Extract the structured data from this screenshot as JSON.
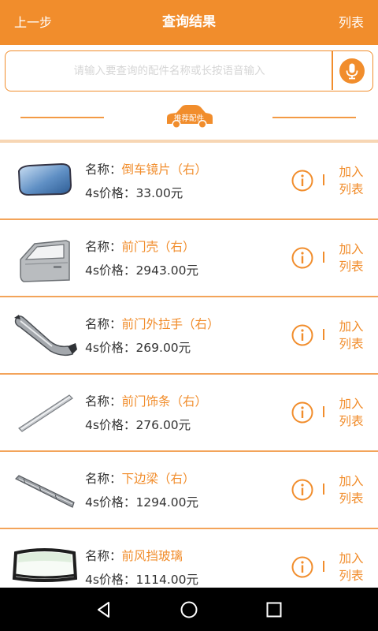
{
  "topbar": {
    "back_label": "上一步",
    "title": "查询结果",
    "list_label": "列表"
  },
  "search": {
    "placeholder": "请输入要查询的配件名称或长按语音输入",
    "mic_icon": "microphone-icon"
  },
  "recommend": {
    "label": "推荐配件",
    "icon": "car-icon"
  },
  "colors": {
    "accent": "#f18d2c",
    "divider": "#f3a45a",
    "text": "#333333"
  },
  "items": [
    {
      "name_prefix": "名称：",
      "name": "倒车镜片（右）",
      "price_prefix": "4s价格：",
      "price": "33.00元",
      "add_label_1": "加入",
      "add_label_2": "列表",
      "thumb": "mirror-glass-image"
    },
    {
      "name_prefix": "名称：",
      "name": "前门壳（右）",
      "price_prefix": "4s价格：",
      "price": "2943.00元",
      "add_label_1": "加入",
      "add_label_2": "列表",
      "thumb": "front-door-shell-image"
    },
    {
      "name_prefix": "名称：",
      "name": "前门外拉手（右）",
      "price_prefix": "4s价格：",
      "price": "269.00元",
      "add_label_1": "加入",
      "add_label_2": "列表",
      "thumb": "door-handle-image"
    },
    {
      "name_prefix": "名称：",
      "name": "前门饰条（右）",
      "price_prefix": "4s价格：",
      "price": "276.00元",
      "add_label_1": "加入",
      "add_label_2": "列表",
      "thumb": "door-trim-strip-image"
    },
    {
      "name_prefix": "名称：",
      "name": "下边梁（右）",
      "price_prefix": "4s价格：",
      "price": "1294.00元",
      "add_label_1": "加入",
      "add_label_2": "列表",
      "thumb": "side-sill-image"
    },
    {
      "name_prefix": "名称：",
      "name": "前风挡玻璃",
      "price_prefix": "4s价格：",
      "price": "1114.00元",
      "add_label_1": "加入",
      "add_label_2": "列表",
      "thumb": "windshield-image"
    }
  ],
  "navbar": {
    "back_icon": "nav-back-icon",
    "home_icon": "nav-home-icon",
    "recents_icon": "nav-recents-icon"
  }
}
